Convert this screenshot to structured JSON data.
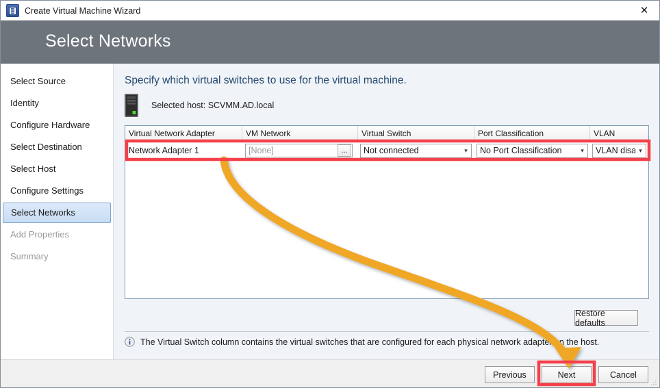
{
  "window": {
    "title": "Create Virtual Machine Wizard",
    "app_icon": "virtual-machine-icon",
    "close_label": "✕"
  },
  "banner": {
    "title": "Select Networks"
  },
  "sidebar": {
    "items": [
      {
        "label": "Select Source",
        "state": "enabled"
      },
      {
        "label": "Identity",
        "state": "enabled"
      },
      {
        "label": "Configure Hardware",
        "state": "enabled"
      },
      {
        "label": "Select Destination",
        "state": "enabled"
      },
      {
        "label": "Select Host",
        "state": "enabled"
      },
      {
        "label": "Configure Settings",
        "state": "enabled"
      },
      {
        "label": "Select Networks",
        "state": "selected"
      },
      {
        "label": "Add Properties",
        "state": "disabled"
      },
      {
        "label": "Summary",
        "state": "disabled"
      }
    ]
  },
  "main": {
    "instruction": "Specify which virtual switches to use for the virtual machine.",
    "host": {
      "icon": "server-host-icon",
      "label": "Selected host:  SCVMM.AD.local"
    },
    "grid": {
      "columns": [
        "Virtual Network Adapter",
        "VM Network",
        "Virtual Switch",
        "Port Classification",
        "VLAN"
      ],
      "rows": [
        {
          "adapter": "Network Adapter 1",
          "vm_network_value": "",
          "vm_network_placeholder": "[None]",
          "vm_network_browse": "...",
          "virtual_switch": "Not connected",
          "port_classification": "No Port Classification",
          "vlan": "VLAN disal"
        }
      ]
    },
    "restore_defaults_label": "Restore defaults",
    "note": {
      "icon": "info-icon",
      "text": "The Virtual Switch column contains the virtual switches that are configured for each physical network adapter on the host."
    }
  },
  "footer": {
    "previous_label": "Previous",
    "next_label": "Next",
    "cancel_label": "Cancel"
  },
  "annotations": {
    "highlight_color": "#f4404a",
    "arrow_color": "#f0a726",
    "highlights": [
      {
        "name": "grid-row-highlight",
        "target": "Network Adapter 1 row"
      },
      {
        "name": "next-button-highlight",
        "target": "Next"
      }
    ],
    "arrow": {
      "name": "guidance-arrow",
      "from": "grid-row",
      "to": "next-button"
    }
  }
}
